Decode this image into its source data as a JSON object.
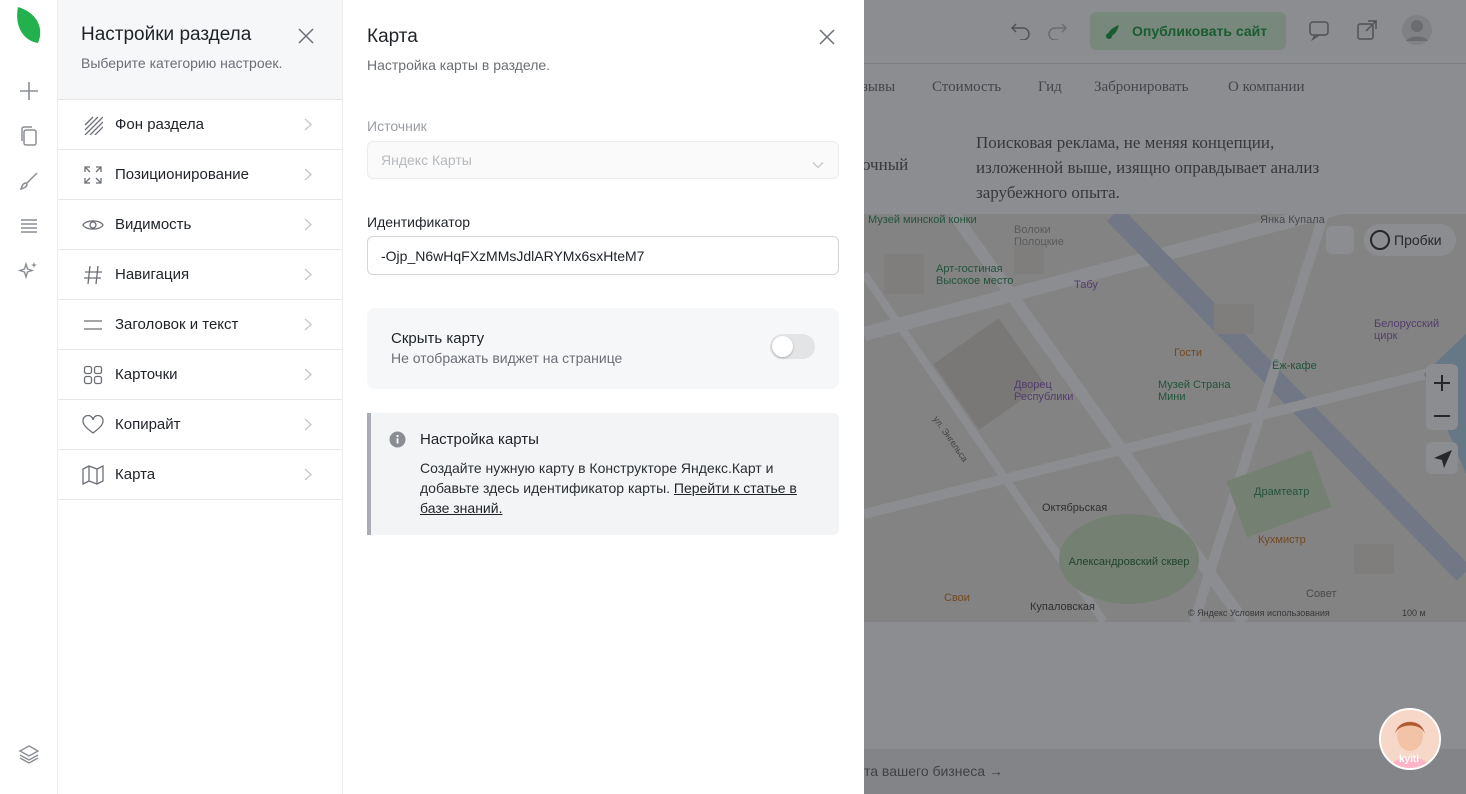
{
  "menu": {
    "title": "Настройки раздела",
    "subtitle": "Выберите категорию настроек.",
    "items": [
      {
        "label": "Фон раздела",
        "icon": "background-hatch-icon"
      },
      {
        "label": "Позиционирование",
        "icon": "expand-corners-icon"
      },
      {
        "label": "Видимость",
        "icon": "eye-icon"
      },
      {
        "label": "Навигация",
        "icon": "hash-icon"
      },
      {
        "label": "Заголовок и текст",
        "icon": "text-lines-icon"
      },
      {
        "label": "Карточки",
        "icon": "cards-grid-icon"
      },
      {
        "label": "Копирайт",
        "icon": "heart-icon"
      },
      {
        "label": "Карта",
        "icon": "map-icon"
      }
    ]
  },
  "detail": {
    "title": "Карта",
    "subtitle": "Настройка карты в разделе.",
    "source_label": "Источник",
    "source_value": "Яндекс Карты",
    "id_label": "Идентификатор",
    "id_value": "-Ojp_N6wHqFXzMMsJdlARYMx6sxHteM7",
    "hide_title": "Скрыть карту",
    "hide_sub": "Не отображать виджет на странице",
    "hide_enabled": false,
    "info_title": "Настройка карты",
    "info_text": "Создайте нужную карту в Конструкторе Яндекс.Карт и добавьте здесь идентификатор карты.",
    "info_link": "Перейти к статье в базе знаний."
  },
  "preview": {
    "publish_label": "Опубликовать сайт",
    "nav": [
      "зывы",
      "Стоимость",
      "Гид",
      "Забронировать",
      "О компании"
    ],
    "lead_text": "Поисковая реклама, не меняя концепции, изложенной выше, изящно оправдывает анализ зарубежного опыта.",
    "lead_fragment": "очный",
    "footer_text": "та вашего бизнеса →",
    "avatar_text": "kyiti",
    "map": {
      "traffic_label": "Пробки",
      "labels": [
        {
          "text": "Музей минской конки"
        },
        {
          "text": "Волоки Полоцкие"
        },
        {
          "text": "Янка Купала"
        },
        {
          "text": "Арт-гостиная Высокое место"
        },
        {
          "text": "Табу"
        },
        {
          "text": "Белорусский цирк"
        },
        {
          "text": "Гости"
        },
        {
          "text": "Ёж-кафе"
        },
        {
          "text": "Дворец Республики"
        },
        {
          "text": "Музей Страна Мини"
        },
        {
          "text": "ул. Энгельса"
        },
        {
          "text": "Драмтеатр"
        },
        {
          "text": "Октябрьская"
        },
        {
          "text": "Кухмистр"
        },
        {
          "text": "Александровский сквер"
        },
        {
          "text": "Свои"
        },
        {
          "text": "Купаловская"
        },
        {
          "text": "Совет"
        },
        {
          "text": "© Яндекс  Условия использования"
        },
        {
          "text": "100 м"
        }
      ]
    }
  },
  "colors": {
    "accent_green": "#199c3e",
    "publish_bg": "#d6f5d8",
    "overlay": "rgba(25,28,33,0.5)"
  }
}
